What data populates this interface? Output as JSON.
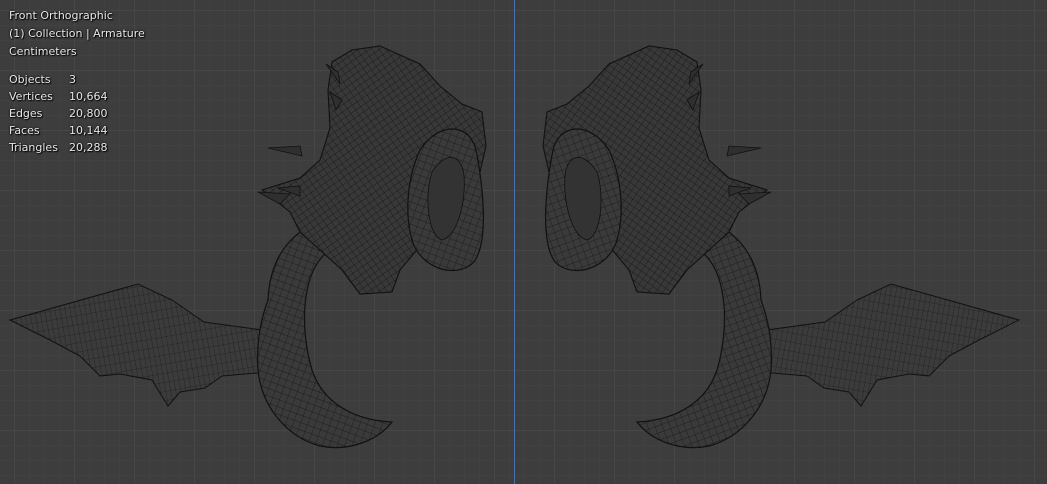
{
  "viewport": {
    "view_name": "Front Orthographic",
    "context": "(1) Collection | Armature",
    "units": "Centimeters"
  },
  "stats": [
    {
      "label": "Objects",
      "value": "3"
    },
    {
      "label": "Vertices",
      "value": "10,664"
    },
    {
      "label": "Edges",
      "value": "20,800"
    },
    {
      "label": "Faces",
      "value": "10,144"
    },
    {
      "label": "Triangles",
      "value": "20,288"
    }
  ],
  "colors": {
    "background": "#3d3d3d",
    "grid": "#474747",
    "axis_line": "#4a72b0",
    "mesh_fill": "#3a3a3a",
    "wire": "#111111",
    "text": "#e8e8e8"
  }
}
